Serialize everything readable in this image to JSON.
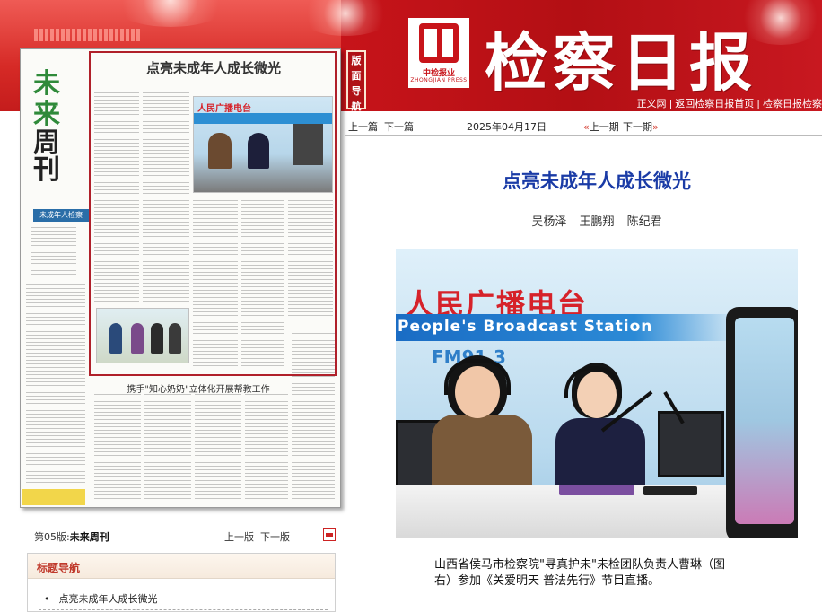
{
  "header": {
    "publication_title": "检察日报",
    "logo_text": "中检报业",
    "logo_sub": "ZHONGJIAN PRESS",
    "links": [
      "正义网",
      "返回检察日报首页",
      "检察日报检察"
    ],
    "nav_tab_chars": [
      "版",
      "面",
      "导",
      "航"
    ]
  },
  "issue_bar": {
    "prev_article": "上一篇",
    "next_article": "下一篇",
    "date": "2025年04月17日",
    "prev_issue": "上一期",
    "next_issue": "下一期"
  },
  "newspaper_thumb": {
    "big_chars": [
      "未",
      "来"
    ],
    "big_char_weekly": "周\n刊",
    "section_label": "未成年人检察",
    "title": "点亮未成年人成长微光",
    "station_label": "人民广播电台",
    "bottom_title": "携手\"知心奶奶\"立体化开展帮教工作"
  },
  "article": {
    "title": "点亮未成年人成长微光",
    "authors": "吴杨泽 王鹏翔 陈纪君",
    "photo": {
      "station_cn": "人民广播电台",
      "station_en": "People's Broadcast Station",
      "frequency": "FM91.3"
    },
    "caption": "山西省侯马市检察院\"寻真护未\"未检团队负责人曹琳（图右）参加《关爱明天 普法先行》节目直播。"
  },
  "page_footer": {
    "page_number": "第05版:",
    "page_name": "未来周刊",
    "prev_page": "上一版",
    "next_page": "下一版"
  },
  "title_nav": {
    "heading": "标题导航",
    "items": [
      "点亮未成年人成长微光"
    ]
  },
  "colors": {
    "header_red": "#c8141a",
    "title_blue": "#1a3ba6",
    "nav_heading_red": "#c0392b"
  }
}
